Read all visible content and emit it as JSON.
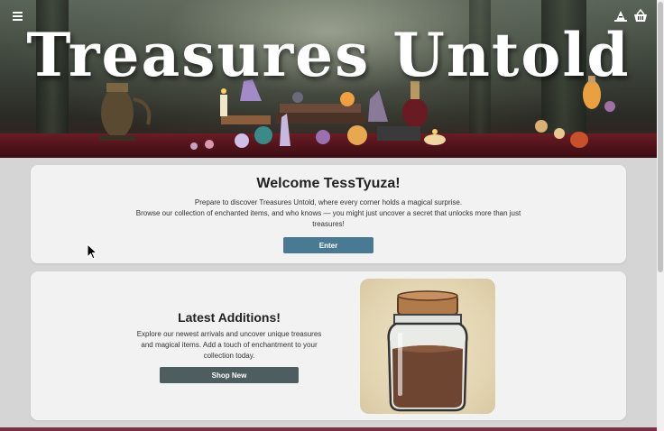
{
  "header": {
    "site_title": "Treasures Untold",
    "menu_icon": "hamburger-menu-icon",
    "profile_icon": "wizard-hat-icon",
    "cart_icon": "basket-icon"
  },
  "welcome": {
    "heading": "Welcome TessTyuza!",
    "line1": "Prepare to discover Treasures Untold, where every corner holds a magical surprise.",
    "line2": "Browse our collection of enchanted items, and who knows — you might just uncover a secret that unlocks more than just treasures!",
    "button_label": "Enter"
  },
  "latest": {
    "heading": "Latest Additions!",
    "description": "Explore our newest arrivals and uncover unique treasures and magical items. Add a touch of enchantment to your collection today.",
    "button_label": "Shop New",
    "image_icon": "cork-jar-image"
  },
  "colors": {
    "enter_button": "#4a7a93",
    "shop_button": "#4e5d60",
    "card_bg": "#f2f2f2",
    "page_bg": "#d6d5d5",
    "accent_strip": "#7a2f47"
  }
}
